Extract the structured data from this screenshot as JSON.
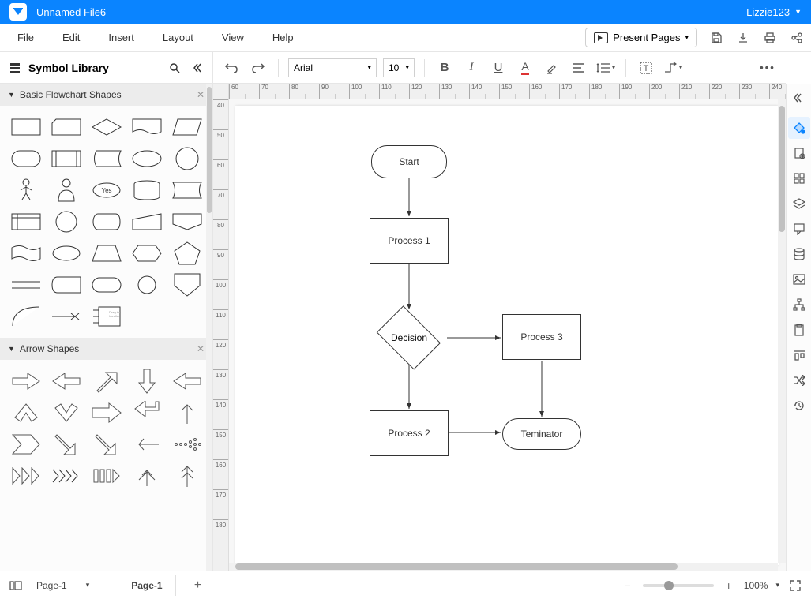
{
  "title_bar": {
    "filename": "Unnamed File6",
    "username": "Lizzie123"
  },
  "menu": {
    "items": [
      "File",
      "Edit",
      "Insert",
      "Layout",
      "View",
      "Help"
    ],
    "present": "Present Pages"
  },
  "symbol_panel": {
    "title": "Symbol Library",
    "cat1": "Basic Flowchart Shapes",
    "cat2": "Arrow Shapes",
    "yes_label": "Yes"
  },
  "toolbar": {
    "font": "Arial",
    "size": "10"
  },
  "ruler_h": [
    "60",
    "70",
    "80",
    "90",
    "100",
    "110",
    "120",
    "130",
    "140",
    "150",
    "160",
    "170",
    "180",
    "190",
    "200",
    "210",
    "220",
    "230",
    "240"
  ],
  "ruler_v": [
    "40",
    "50",
    "60",
    "70",
    "80",
    "90",
    "100",
    "110",
    "120",
    "130",
    "140",
    "150",
    "160",
    "170",
    "180"
  ],
  "flowchart": {
    "start": "Start",
    "p1": "Process 1",
    "dec": "Decision",
    "p2": "Process 2",
    "p3": "Process 3",
    "term": "Teminator"
  },
  "status": {
    "page_drop": "Page-1",
    "page_tab": "Page-1",
    "zoom": "100%"
  }
}
